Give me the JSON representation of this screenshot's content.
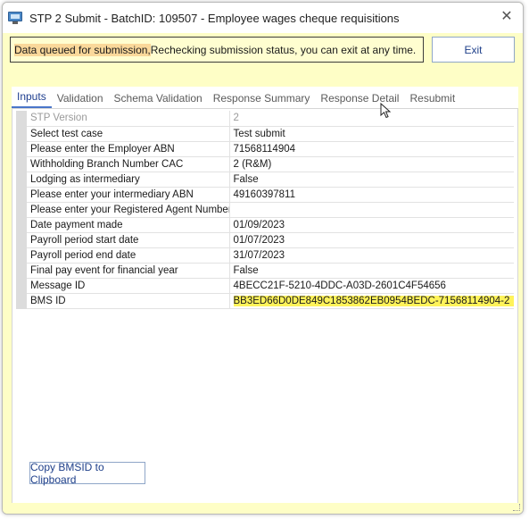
{
  "window": {
    "title": "STP 2 Submit - BatchID: 109507 - Employee wages cheque requisitions",
    "close_symbol": "✕"
  },
  "status": {
    "highlighted_text": "Data queued for submission, ",
    "rest_text": "Rechecking submission status, you can exit at any time."
  },
  "buttons": {
    "exit": "Exit",
    "copy_bmsid": "Copy BMSID to Clipboard"
  },
  "tabs": [
    {
      "label": "Inputs",
      "active": true
    },
    {
      "label": "Validation",
      "active": false
    },
    {
      "label": "Schema Validation",
      "active": false
    },
    {
      "label": "Response Summary",
      "active": false
    },
    {
      "label": "Response Detail",
      "active": false
    },
    {
      "label": "Resubmit",
      "active": false
    }
  ],
  "grid": {
    "rows": [
      {
        "label": "STP Version",
        "value": "2",
        "disabled": true
      },
      {
        "label": "Select test case",
        "value": "Test submit"
      },
      {
        "label": "Please enter the Employer ABN",
        "value": "71568114904"
      },
      {
        "label": "Withholding Branch Number CAC",
        "value": "2 (R&M)"
      },
      {
        "label": "Lodging as intermediary",
        "value": "False"
      },
      {
        "label": "Please enter your intermediary ABN",
        "value": "49160397811"
      },
      {
        "label": "Please enter your Registered Agent Number",
        "value": ""
      },
      {
        "label": "Date payment made",
        "value": "01/09/2023"
      },
      {
        "label": "Payroll period start date",
        "value": "01/07/2023"
      },
      {
        "label": "Payroll period end date",
        "value": "31/07/2023"
      },
      {
        "label": "Final pay event for financial year",
        "value": "False"
      },
      {
        "label": "Message ID",
        "value": "4BECC21F-5210-4DDC-A03D-2601C4F54656"
      },
      {
        "label": "BMS ID",
        "value": "BB3ED66D0DE849C1853862EB0954BEDC-71568114904-2",
        "highlight": true
      }
    ]
  },
  "colors": {
    "window_bg": "#fefec6",
    "status_highlight": "#fad89a",
    "value_highlight": "#fff35a",
    "accent": "#1e3f8a"
  }
}
